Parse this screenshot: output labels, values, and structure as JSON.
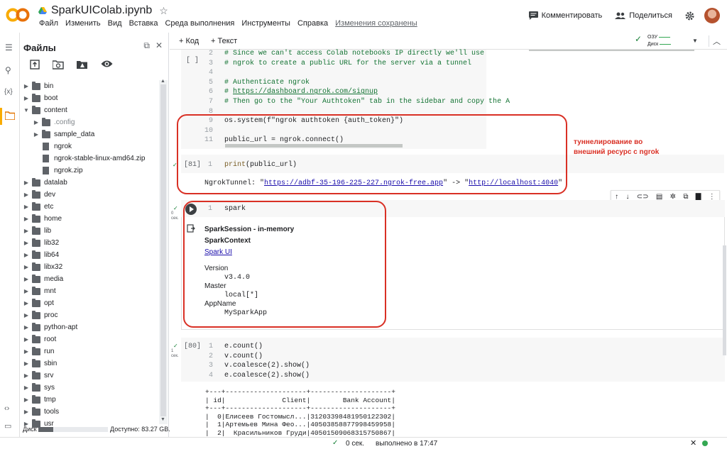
{
  "header": {
    "title": "SparkUIColab.ipynb",
    "menu": [
      "Файл",
      "Изменить",
      "Вид",
      "Вставка",
      "Среда выполнения",
      "Инструменты",
      "Справка"
    ],
    "saved": "Изменения сохранены",
    "comment": "Комментировать",
    "share": "Поделиться"
  },
  "files": {
    "title": "Файлы",
    "tree": [
      {
        "name": "bin",
        "type": "folder",
        "depth": 0,
        "expanded": false
      },
      {
        "name": "boot",
        "type": "folder",
        "depth": 0,
        "expanded": false
      },
      {
        "name": "content",
        "type": "folder",
        "depth": 0,
        "expanded": true
      },
      {
        "name": ".config",
        "type": "folder",
        "depth": 1,
        "expanded": false
      },
      {
        "name": "sample_data",
        "type": "folder",
        "depth": 1,
        "expanded": false
      },
      {
        "name": "ngrok",
        "type": "file",
        "depth": 1
      },
      {
        "name": "ngrok-stable-linux-amd64.zip",
        "type": "file",
        "depth": 1
      },
      {
        "name": "ngrok.zip",
        "type": "file",
        "depth": 1
      },
      {
        "name": "datalab",
        "type": "folder",
        "depth": 0,
        "expanded": false
      },
      {
        "name": "dev",
        "type": "folder",
        "depth": 0,
        "expanded": false
      },
      {
        "name": "etc",
        "type": "folder",
        "depth": 0,
        "expanded": false
      },
      {
        "name": "home",
        "type": "folder",
        "depth": 0,
        "expanded": false
      },
      {
        "name": "lib",
        "type": "folder",
        "depth": 0,
        "expanded": false
      },
      {
        "name": "lib32",
        "type": "folder",
        "depth": 0,
        "expanded": false
      },
      {
        "name": "lib64",
        "type": "folder",
        "depth": 0,
        "expanded": false
      },
      {
        "name": "libx32",
        "type": "folder",
        "depth": 0,
        "expanded": false
      },
      {
        "name": "media",
        "type": "folder",
        "depth": 0,
        "expanded": false
      },
      {
        "name": "mnt",
        "type": "folder",
        "depth": 0,
        "expanded": false
      },
      {
        "name": "opt",
        "type": "folder",
        "depth": 0,
        "expanded": false
      },
      {
        "name": "proc",
        "type": "folder",
        "depth": 0,
        "expanded": false
      },
      {
        "name": "python-apt",
        "type": "folder",
        "depth": 0,
        "expanded": false
      },
      {
        "name": "root",
        "type": "folder",
        "depth": 0,
        "expanded": false
      },
      {
        "name": "run",
        "type": "folder",
        "depth": 0,
        "expanded": false
      },
      {
        "name": "sbin",
        "type": "folder",
        "depth": 0,
        "expanded": false
      },
      {
        "name": "srv",
        "type": "folder",
        "depth": 0,
        "expanded": false
      },
      {
        "name": "sys",
        "type": "folder",
        "depth": 0,
        "expanded": false
      },
      {
        "name": "tmp",
        "type": "folder",
        "depth": 0,
        "expanded": false
      },
      {
        "name": "tools",
        "type": "folder",
        "depth": 0,
        "expanded": false
      },
      {
        "name": "usr",
        "type": "folder",
        "depth": 0,
        "expanded": false
      }
    ],
    "disk_label": "Диск",
    "disk_free": "Доступно: 83.27 GB.",
    "disk_used_fraction": 0.21
  },
  "toolbar": {
    "add_code": "+ Код",
    "add_text": "+ Текст",
    "ram": "ОЗУ",
    "disk": "Диск"
  },
  "cell1": {
    "exec": "[ ]",
    "lines": [
      {
        "n": "2",
        "text": "# Since we can't access Colab notebooks IP directly we'll use"
      },
      {
        "n": "3",
        "text": "# ngrok to create a public URL for the server via a tunnel"
      },
      {
        "n": "4",
        "text": ""
      },
      {
        "n": "5",
        "text": "# Authenticate ngrok"
      },
      {
        "n": "6",
        "text_prefix": "# ",
        "link": "https://dashboard.ngrok.com/signup"
      },
      {
        "n": "7",
        "text": "# Then go to the \"Your Authtoken\" tab in the sidebar and copy the A"
      },
      {
        "n": "8",
        "text": ""
      },
      {
        "n": "9",
        "text": "os.system(f\"ngrok authtoken {auth_token}\")"
      },
      {
        "n": "10",
        "text": ""
      },
      {
        "n": "11",
        "text": "public_url = ngrok.connect()"
      }
    ]
  },
  "cell2": {
    "exec": "[81]",
    "line_n": "1",
    "code": "print(public_url)",
    "out_prefix": "NgrokTunnel: \"",
    "out_link1": "https://adbf-35-196-225-227.ngrok-free.app",
    "out_mid": "\" -> \"",
    "out_link2": "http://localhost:4040",
    "out_suffix": "\""
  },
  "annotation": "туннелирование во\nвнешний ресурс с ngrok",
  "cell3": {
    "line_n": "1",
    "code": "spark",
    "tick_time": "0\nсек.",
    "out_title": "SparkSession - in-memory",
    "out_ctx": "SparkContext",
    "out_link": "Spark UI",
    "version_label": "Version",
    "version": "v3.4.0",
    "master_label": "Master",
    "master": "local[*]",
    "appname_label": "AppName",
    "appname": "MySparkApp"
  },
  "cell4": {
    "exec": "[80]",
    "tick_time": "1\nсек.",
    "lines": [
      {
        "n": "1",
        "text": "e.count()"
      },
      {
        "n": "2",
        "text": "v.count()"
      },
      {
        "n": "3",
        "text": "v.coalesce(2).show()"
      },
      {
        "n": "4",
        "text": "e.coalesce(2).show()"
      }
    ],
    "table": "+---+--------------------+--------------------+\n| id|              Client|        Bank Account|\n+---+--------------------+--------------------+\n|  0|Елисеев Гостомысл...|31203398481950122302|\n|  1|Артемьев Мина Фео...|40503858877998459958|\n|  2|  Красильников Груди|40501509068315750867|"
  },
  "status": {
    "time": "0 сек.",
    "done": "выполнено в 17:47"
  }
}
